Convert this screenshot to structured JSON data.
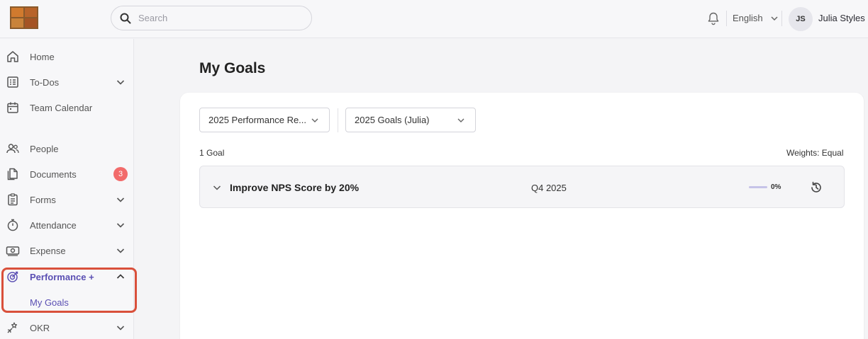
{
  "header": {
    "search_placeholder": "Search",
    "language": "English",
    "user_initials": "JS",
    "user_name": "Julia Styles"
  },
  "sidebar": {
    "items": [
      {
        "label": "Home",
        "icon": "home-icon"
      },
      {
        "label": "To-Dos",
        "icon": "todo-list-icon",
        "expandable": true
      },
      {
        "label": "Team Calendar",
        "icon": "calendar-icon"
      },
      {
        "label": "People",
        "icon": "people-icon"
      },
      {
        "label": "Documents",
        "icon": "documents-icon",
        "badge": "3"
      },
      {
        "label": "Forms",
        "icon": "forms-icon",
        "expandable": true
      },
      {
        "label": "Attendance",
        "icon": "stopwatch-icon",
        "expandable": true
      },
      {
        "label": "Expense",
        "icon": "money-icon",
        "expandable": true
      },
      {
        "label": "Performance +",
        "icon": "performance-icon",
        "expanded": true
      },
      {
        "label": "OKR",
        "icon": "okr-icon",
        "expandable": true
      }
    ],
    "performance_subitems": [
      {
        "label": "My Goals"
      }
    ]
  },
  "main": {
    "title": "My Goals",
    "filters": {
      "review_cycle": "2025 Performance Re...",
      "goal_set": "2025 Goals (Julia)"
    },
    "goal_count": "1 Goal",
    "weights": "Weights: Equal",
    "goals": [
      {
        "title": "Improve NPS Score by 20%",
        "quarter": "Q4 2025",
        "progress": 0,
        "progress_label": "0%"
      }
    ]
  },
  "colors": {
    "accent": "#5a4fb3",
    "badge": "#f26b6b",
    "highlight_border": "#d9503b"
  }
}
